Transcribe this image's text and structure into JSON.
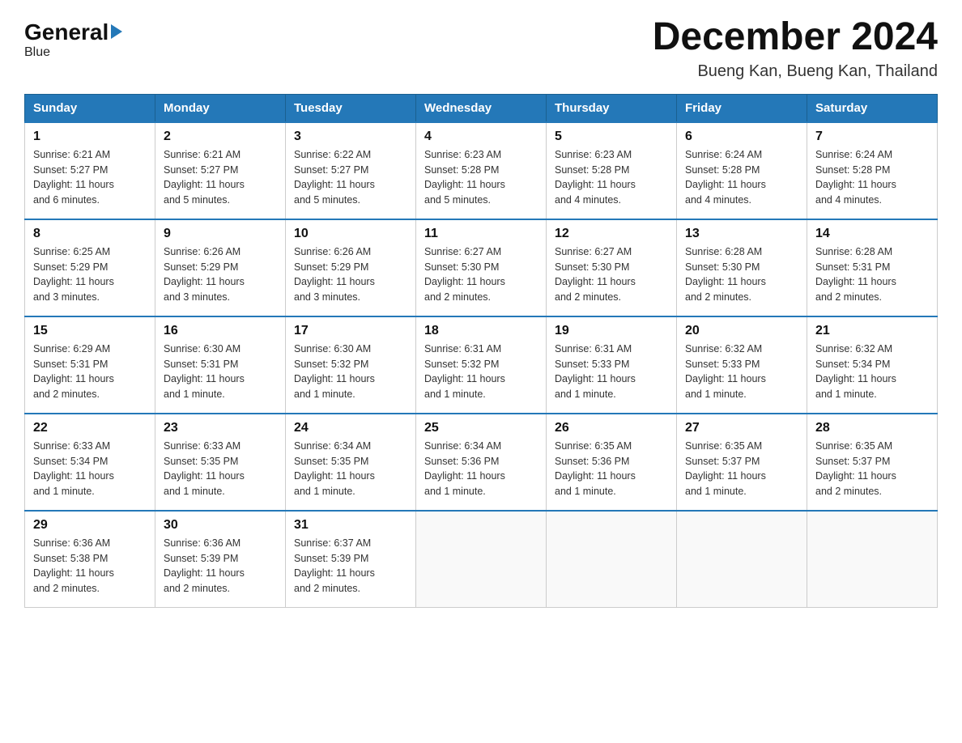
{
  "logo": {
    "general": "General",
    "blue": "Blue"
  },
  "header": {
    "month": "December 2024",
    "location": "Bueng Kan, Bueng Kan, Thailand"
  },
  "days_of_week": [
    "Sunday",
    "Monday",
    "Tuesday",
    "Wednesday",
    "Thursday",
    "Friday",
    "Saturday"
  ],
  "weeks": [
    [
      {
        "day": "1",
        "sunrise": "6:21 AM",
        "sunset": "5:27 PM",
        "daylight": "11 hours and 6 minutes."
      },
      {
        "day": "2",
        "sunrise": "6:21 AM",
        "sunset": "5:27 PM",
        "daylight": "11 hours and 5 minutes."
      },
      {
        "day": "3",
        "sunrise": "6:22 AM",
        "sunset": "5:27 PM",
        "daylight": "11 hours and 5 minutes."
      },
      {
        "day": "4",
        "sunrise": "6:23 AM",
        "sunset": "5:28 PM",
        "daylight": "11 hours and 5 minutes."
      },
      {
        "day": "5",
        "sunrise": "6:23 AM",
        "sunset": "5:28 PM",
        "daylight": "11 hours and 4 minutes."
      },
      {
        "day": "6",
        "sunrise": "6:24 AM",
        "sunset": "5:28 PM",
        "daylight": "11 hours and 4 minutes."
      },
      {
        "day": "7",
        "sunrise": "6:24 AM",
        "sunset": "5:28 PM",
        "daylight": "11 hours and 4 minutes."
      }
    ],
    [
      {
        "day": "8",
        "sunrise": "6:25 AM",
        "sunset": "5:29 PM",
        "daylight": "11 hours and 3 minutes."
      },
      {
        "day": "9",
        "sunrise": "6:26 AM",
        "sunset": "5:29 PM",
        "daylight": "11 hours and 3 minutes."
      },
      {
        "day": "10",
        "sunrise": "6:26 AM",
        "sunset": "5:29 PM",
        "daylight": "11 hours and 3 minutes."
      },
      {
        "day": "11",
        "sunrise": "6:27 AM",
        "sunset": "5:30 PM",
        "daylight": "11 hours and 2 minutes."
      },
      {
        "day": "12",
        "sunrise": "6:27 AM",
        "sunset": "5:30 PM",
        "daylight": "11 hours and 2 minutes."
      },
      {
        "day": "13",
        "sunrise": "6:28 AM",
        "sunset": "5:30 PM",
        "daylight": "11 hours and 2 minutes."
      },
      {
        "day": "14",
        "sunrise": "6:28 AM",
        "sunset": "5:31 PM",
        "daylight": "11 hours and 2 minutes."
      }
    ],
    [
      {
        "day": "15",
        "sunrise": "6:29 AM",
        "sunset": "5:31 PM",
        "daylight": "11 hours and 2 minutes."
      },
      {
        "day": "16",
        "sunrise": "6:30 AM",
        "sunset": "5:31 PM",
        "daylight": "11 hours and 1 minute."
      },
      {
        "day": "17",
        "sunrise": "6:30 AM",
        "sunset": "5:32 PM",
        "daylight": "11 hours and 1 minute."
      },
      {
        "day": "18",
        "sunrise": "6:31 AM",
        "sunset": "5:32 PM",
        "daylight": "11 hours and 1 minute."
      },
      {
        "day": "19",
        "sunrise": "6:31 AM",
        "sunset": "5:33 PM",
        "daylight": "11 hours and 1 minute."
      },
      {
        "day": "20",
        "sunrise": "6:32 AM",
        "sunset": "5:33 PM",
        "daylight": "11 hours and 1 minute."
      },
      {
        "day": "21",
        "sunrise": "6:32 AM",
        "sunset": "5:34 PM",
        "daylight": "11 hours and 1 minute."
      }
    ],
    [
      {
        "day": "22",
        "sunrise": "6:33 AM",
        "sunset": "5:34 PM",
        "daylight": "11 hours and 1 minute."
      },
      {
        "day": "23",
        "sunrise": "6:33 AM",
        "sunset": "5:35 PM",
        "daylight": "11 hours and 1 minute."
      },
      {
        "day": "24",
        "sunrise": "6:34 AM",
        "sunset": "5:35 PM",
        "daylight": "11 hours and 1 minute."
      },
      {
        "day": "25",
        "sunrise": "6:34 AM",
        "sunset": "5:36 PM",
        "daylight": "11 hours and 1 minute."
      },
      {
        "day": "26",
        "sunrise": "6:35 AM",
        "sunset": "5:36 PM",
        "daylight": "11 hours and 1 minute."
      },
      {
        "day": "27",
        "sunrise": "6:35 AM",
        "sunset": "5:37 PM",
        "daylight": "11 hours and 1 minute."
      },
      {
        "day": "28",
        "sunrise": "6:35 AM",
        "sunset": "5:37 PM",
        "daylight": "11 hours and 2 minutes."
      }
    ],
    [
      {
        "day": "29",
        "sunrise": "6:36 AM",
        "sunset": "5:38 PM",
        "daylight": "11 hours and 2 minutes."
      },
      {
        "day": "30",
        "sunrise": "6:36 AM",
        "sunset": "5:39 PM",
        "daylight": "11 hours and 2 minutes."
      },
      {
        "day": "31",
        "sunrise": "6:37 AM",
        "sunset": "5:39 PM",
        "daylight": "11 hours and 2 minutes."
      },
      null,
      null,
      null,
      null
    ]
  ],
  "labels": {
    "sunrise": "Sunrise:",
    "sunset": "Sunset:",
    "daylight": "Daylight:"
  }
}
